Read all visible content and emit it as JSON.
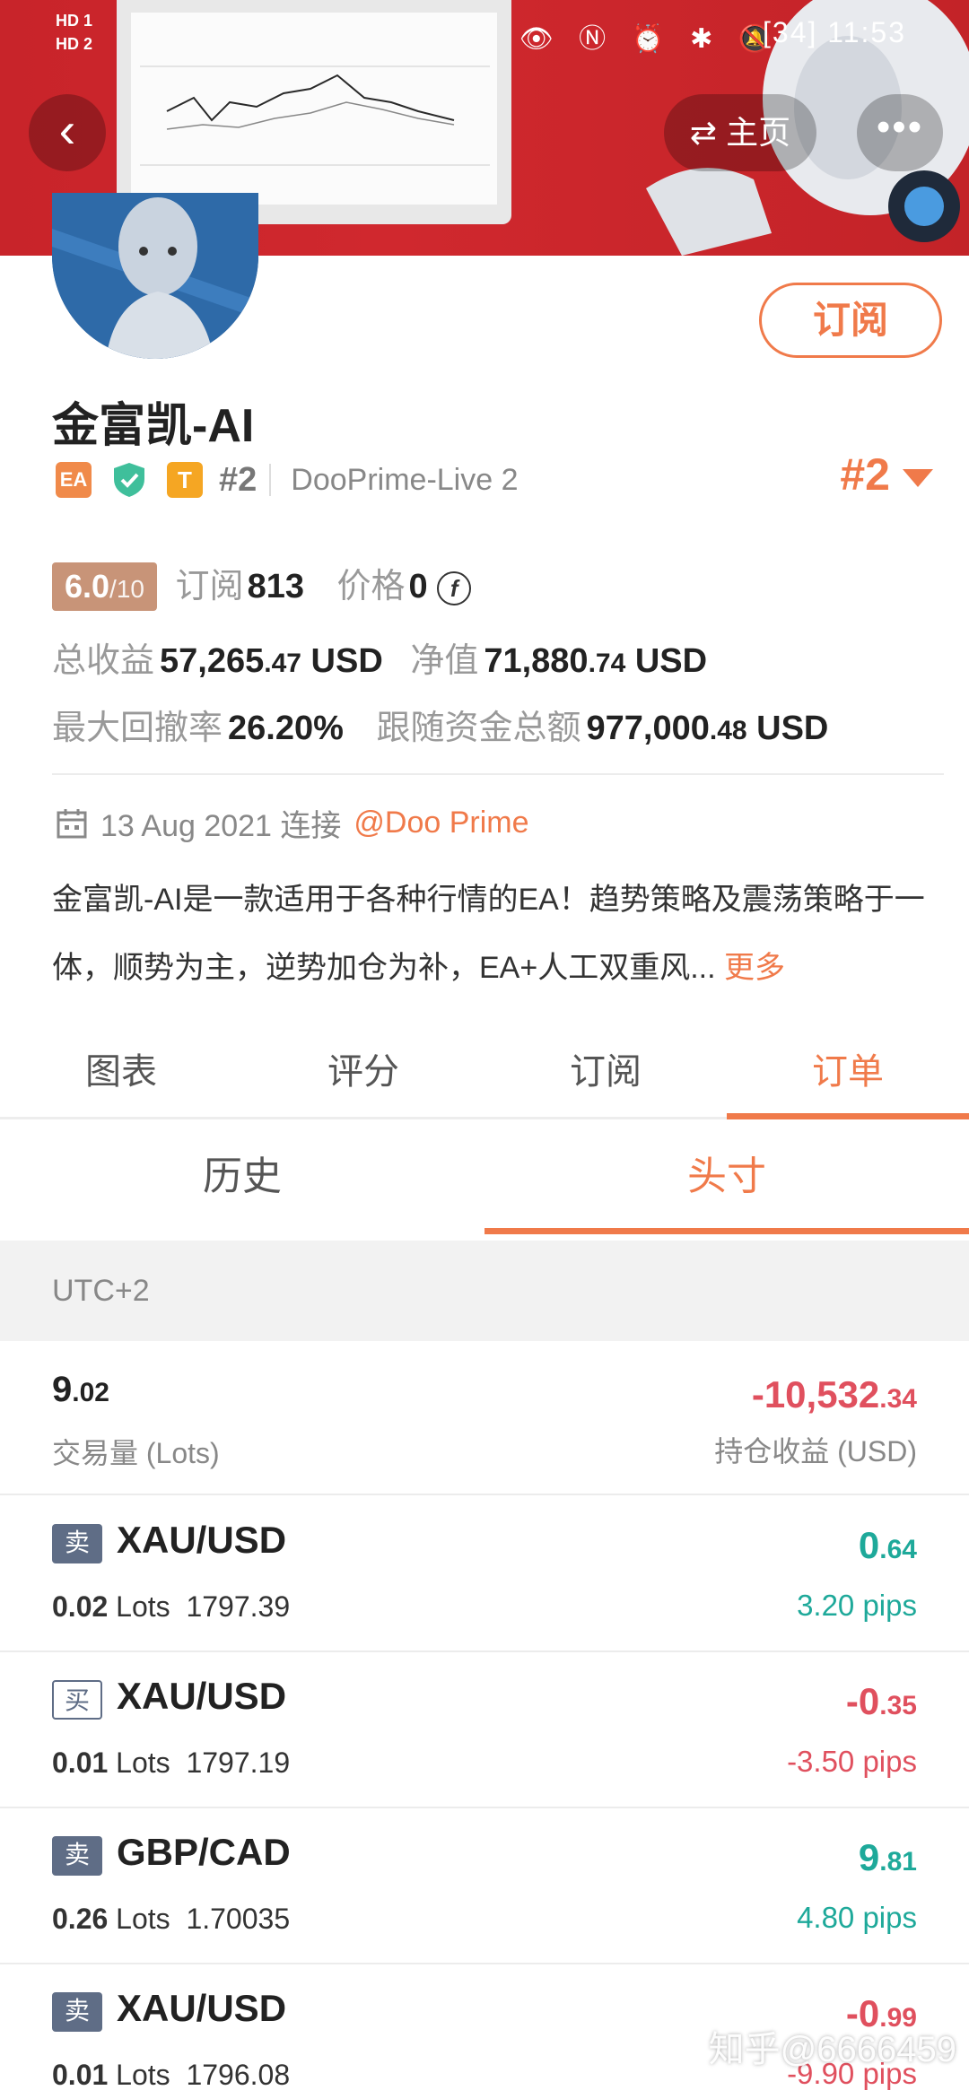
{
  "status_bar": {
    "left": "HD 1\nHD 2",
    "battery": "34",
    "time": "11:53"
  },
  "header": {
    "home_label": "主页",
    "subscribe_label": "订阅"
  },
  "profile": {
    "name": "金富凯-AI",
    "tag_ea": "EA",
    "tag_t": "T",
    "rank": "#2",
    "server": "DooPrime-Live 2",
    "rank_right": "#2"
  },
  "stats": {
    "score": "6.0",
    "score_max": "/10",
    "subs_label": "订阅",
    "subs_value": "813",
    "price_label": "价格",
    "price_value": "0",
    "coin_symbol": "f",
    "total_profit_label": "总收益",
    "total_profit_int": "57,265",
    "total_profit_dec": ".47",
    "total_profit_unit": "USD",
    "equity_label": "净值",
    "equity_int": "71,880",
    "equity_dec": ".74",
    "equity_unit": "USD",
    "drawdown_label": "最大回撤率",
    "drawdown_value": "26.20%",
    "follow_label": "跟随资金总额",
    "follow_int": "977,000",
    "follow_dec": ".48",
    "follow_unit": "USD"
  },
  "connect": {
    "date": "13 Aug 2021 连接",
    "broker": "@Doo Prime"
  },
  "description": {
    "text": "金富凯-AI是一款适用于各种行情的EA！趋势策略及震荡策略于一体，顺势为主，逆势加仓为补，EA+人工双重风...",
    "more": "更多"
  },
  "tabs": [
    "图表",
    "评分",
    "订阅",
    "订单"
  ],
  "subtabs": [
    "历史",
    "头寸"
  ],
  "timezone": "UTC+2",
  "summary": {
    "lots_int": "9",
    "lots_dec": ".02",
    "lots_label": "交易量 (Lots)",
    "pl_int": "-10,532",
    "pl_dec": ".34",
    "pl_label": "持仓收益 (USD)"
  },
  "positions": [
    {
      "side": "卖",
      "type": "sell",
      "symbol": "XAU/USD",
      "lots": "0.02",
      "lots_unit": "Lots",
      "price": "1797.39",
      "val_int": "0",
      "val_dec": ".64",
      "pips": "3.20 pips",
      "dir": "up"
    },
    {
      "side": "买",
      "type": "buy",
      "symbol": "XAU/USD",
      "lots": "0.01",
      "lots_unit": "Lots",
      "price": "1797.19",
      "val_int": "-0",
      "val_dec": ".35",
      "pips": "-3.50 pips",
      "dir": "down"
    },
    {
      "side": "卖",
      "type": "sell",
      "symbol": "GBP/CAD",
      "lots": "0.26",
      "lots_unit": "Lots",
      "price": "1.70035",
      "val_int": "9",
      "val_dec": ".81",
      "pips": "4.80 pips",
      "dir": "up"
    },
    {
      "side": "卖",
      "type": "sell",
      "symbol": "XAU/USD",
      "lots": "0.01",
      "lots_unit": "Lots",
      "price": "1796.08",
      "val_int": "-0",
      "val_dec": ".99",
      "pips": "-9.90 pips",
      "dir": "down"
    }
  ],
  "watermark": "知乎@6666459",
  "colors": {
    "accent": "#f07a4a",
    "up": "#1ea99a",
    "down": "#e0505e",
    "banner": "#c8242a"
  }
}
